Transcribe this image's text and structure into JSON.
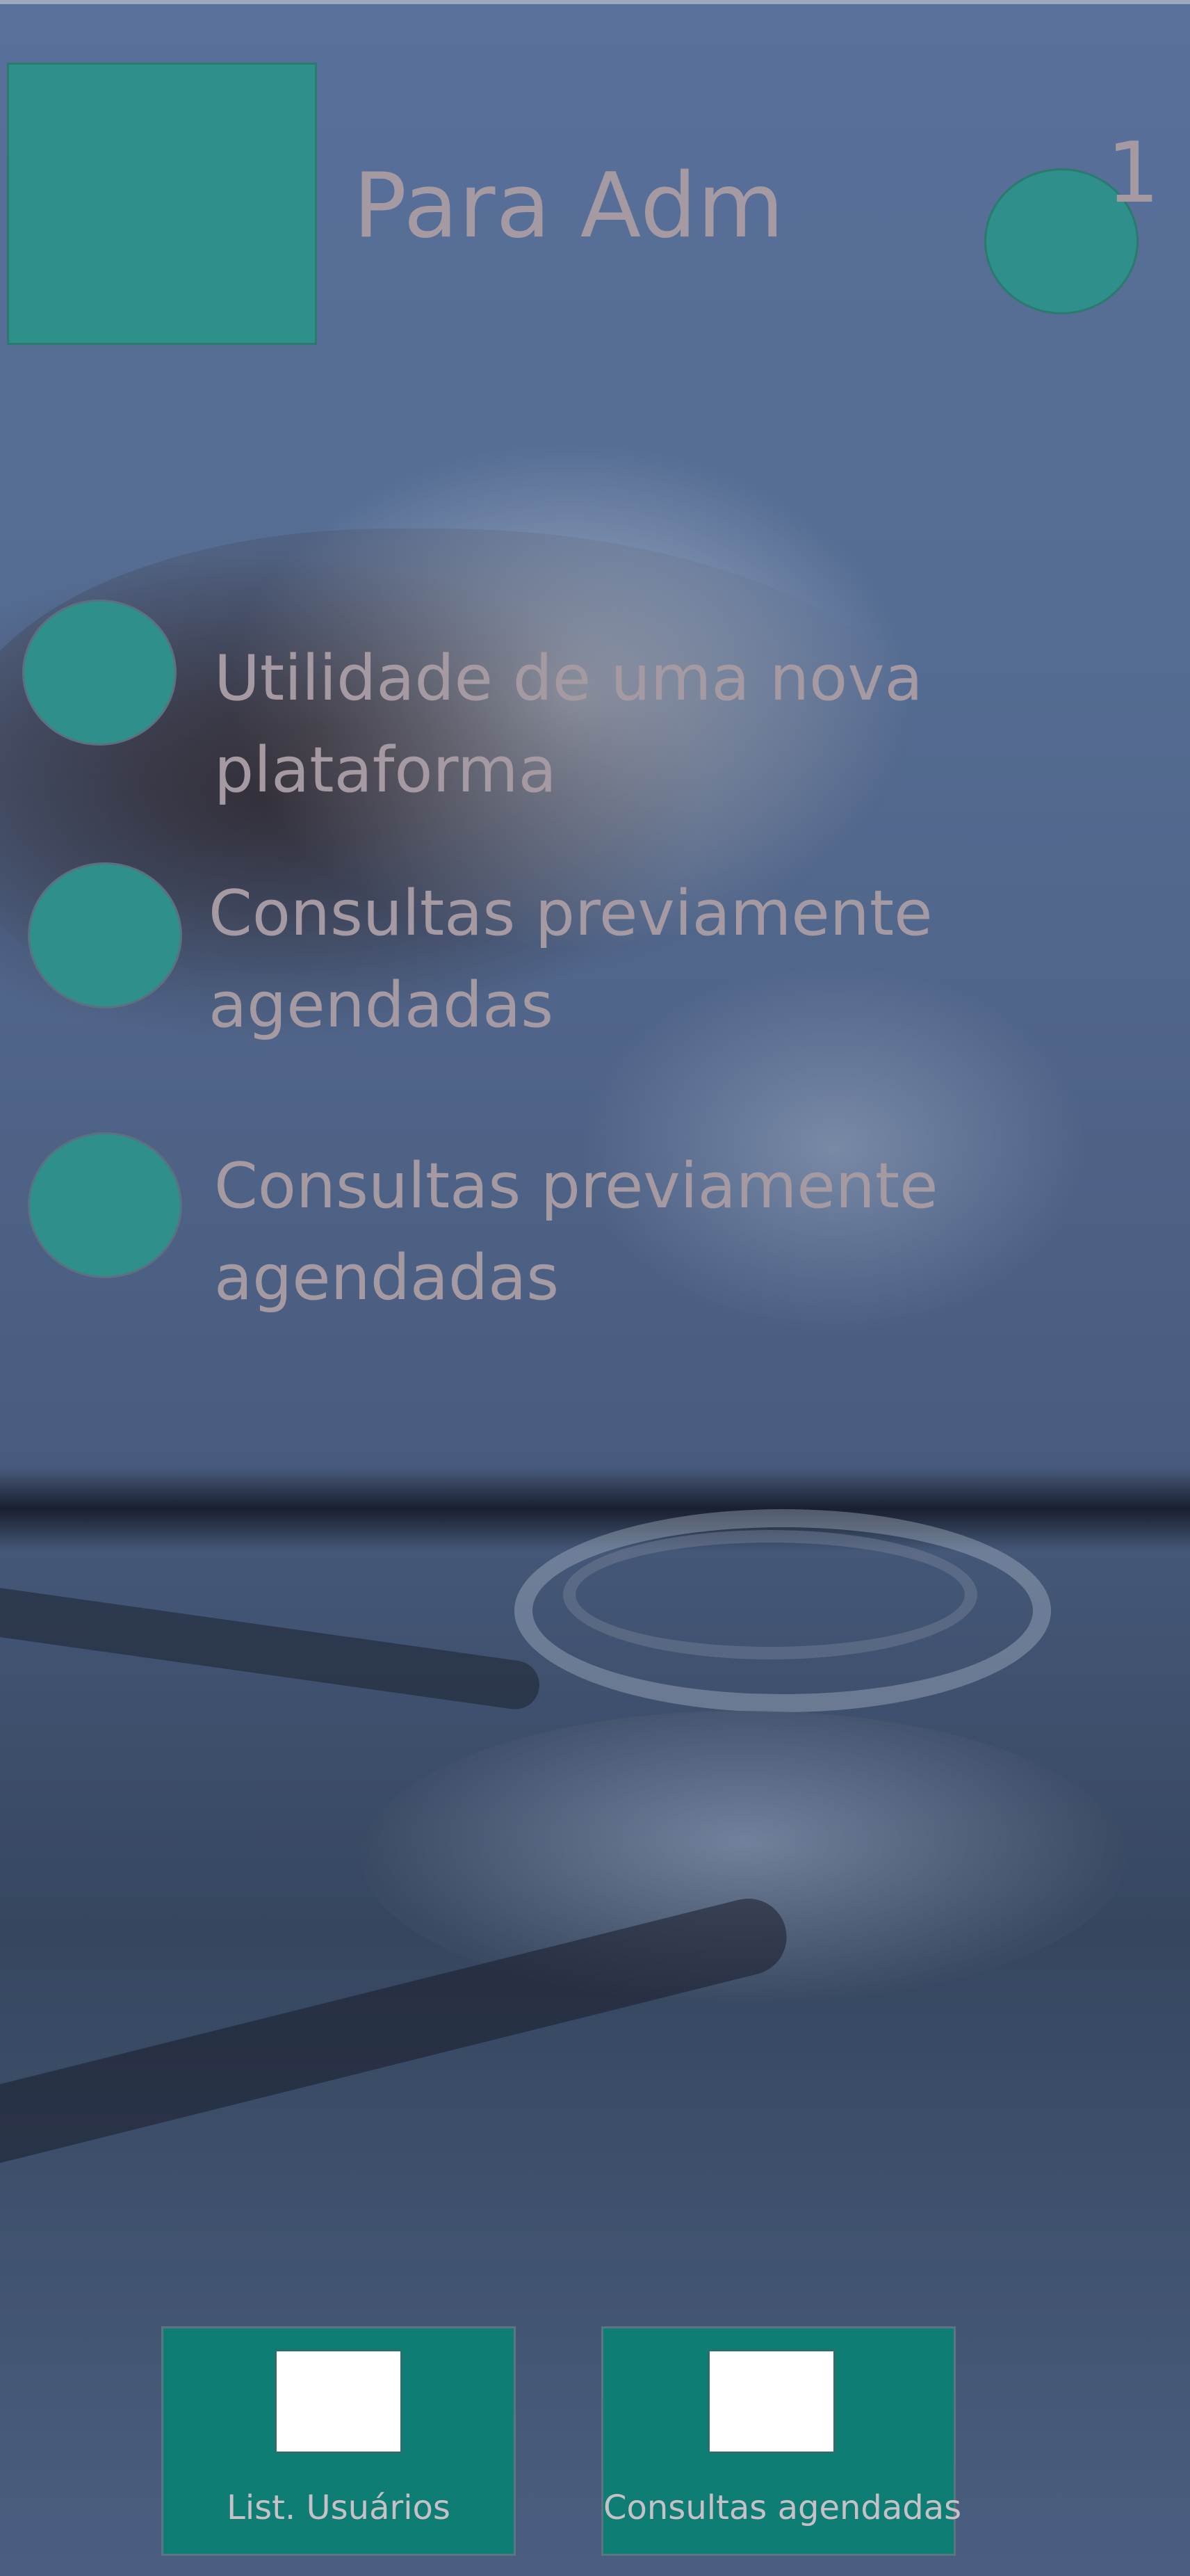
{
  "header": {
    "title": "Para Adm",
    "notification_count": "1"
  },
  "features": [
    {
      "text": "Utilidade de uma nova plataforma"
    },
    {
      "text": "Consultas previamente agendadas"
    },
    {
      "text": "Consultas previamente agendadas"
    }
  ],
  "nav": {
    "users_label": "List. Usuários",
    "appointments_label": "Consultas agendadas"
  },
  "colors": {
    "accent": "#2f8f8a",
    "button": "#0e7e74",
    "text": "#a69aa2"
  }
}
